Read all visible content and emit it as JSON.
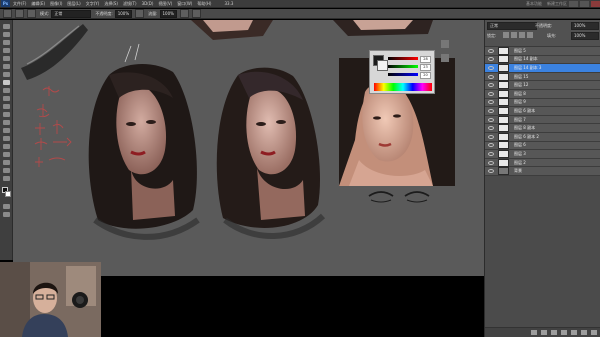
{
  "menubar": {
    "logo": "Ps",
    "items": [
      "文件(F)",
      "编辑(E)",
      "图像(I)",
      "图层(L)",
      "文字(Y)",
      "选择(S)",
      "滤镜(T)",
      "3D(D)",
      "视图(V)",
      "窗口(W)",
      "帮助(H)"
    ],
    "zoom": "33.3",
    "right_text": [
      "基本功能",
      "新建工作区"
    ]
  },
  "options": {
    "mode_label": "模式:",
    "mode_value": "正常",
    "opacity_label": "不透明度:",
    "opacity_value": "100%",
    "flow_label": "流量:",
    "flow_value": "100%"
  },
  "layers": {
    "blend_value": "正常",
    "opacity_label": "不透明度:",
    "opacity_value": "100%",
    "lock_label": "锁定:",
    "fill_label": "填充:",
    "fill_value": "100%",
    "items": [
      {
        "name": "图层 5",
        "selected": false
      },
      {
        "name": "图层 14 副本",
        "selected": false
      },
      {
        "name": "图层 14 副本 3",
        "selected": true
      },
      {
        "name": "图层 15",
        "selected": false
      },
      {
        "name": "图层 12",
        "selected": false
      },
      {
        "name": "图层 8",
        "selected": false
      },
      {
        "name": "图层 9",
        "selected": false
      },
      {
        "name": "图层 6 副本",
        "selected": false
      },
      {
        "name": "图层 7",
        "selected": false
      },
      {
        "name": "图层 8 副本",
        "selected": false
      },
      {
        "name": "图层 6 副本 2",
        "selected": false
      },
      {
        "name": "图层 6",
        "selected": false
      },
      {
        "name": "图层 3",
        "selected": false
      },
      {
        "name": "图层 2",
        "selected": false
      },
      {
        "name": "背景",
        "selected": false
      }
    ]
  },
  "colorpicker": {
    "values": [
      "28",
      "23",
      "20"
    ]
  },
  "colors": {
    "accent": "#3b82e0",
    "canvas": "#5a5a5a",
    "panel": "#4b4b4b"
  }
}
